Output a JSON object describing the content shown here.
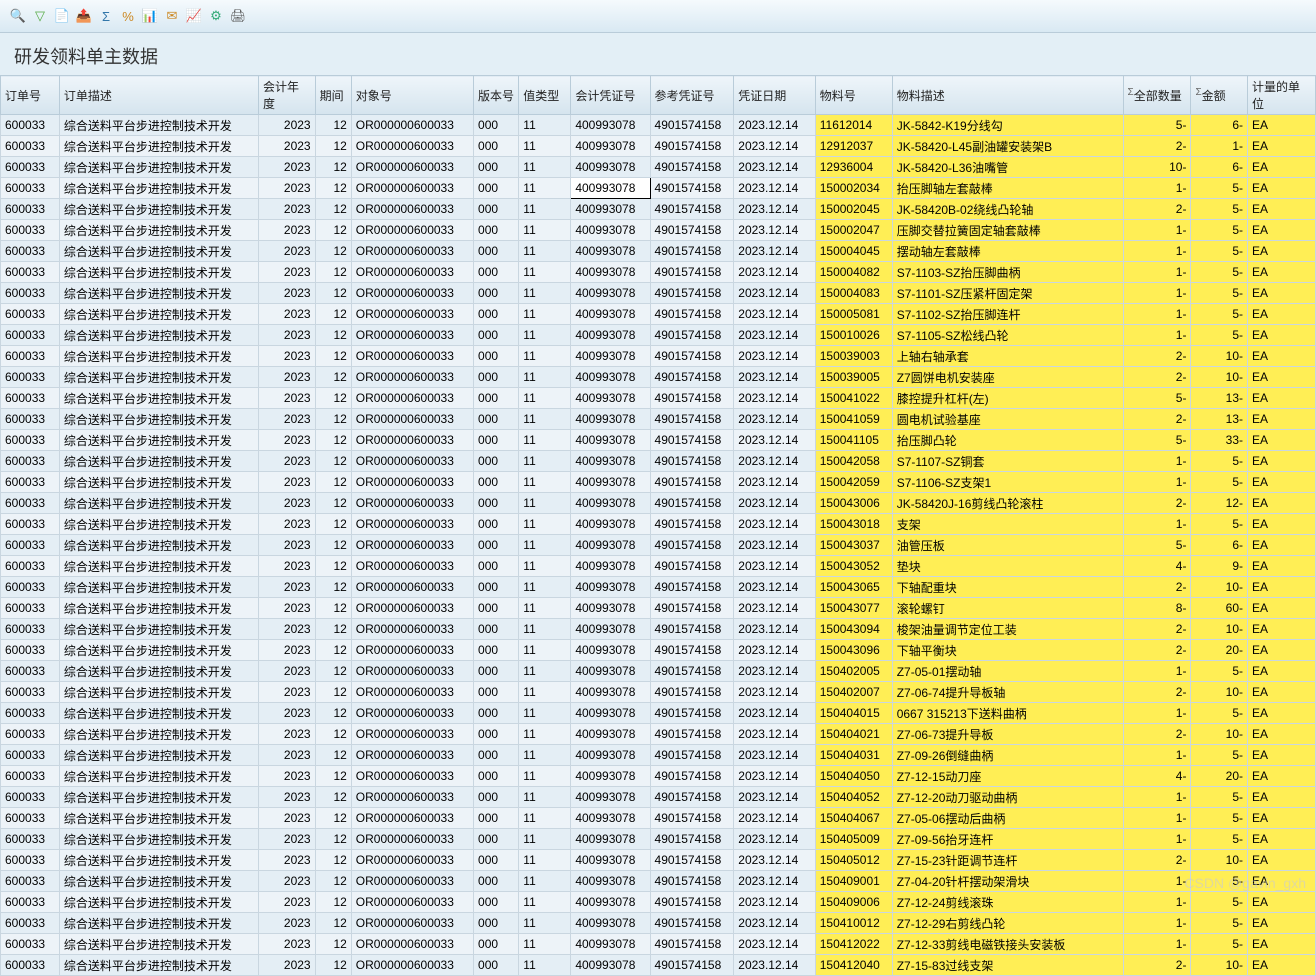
{
  "page_title": "研发领料单主数据",
  "columns": [
    "订单号",
    "订单描述",
    "会计年度",
    "期间",
    "对象号",
    "版本号",
    "值类型",
    "会计凭证号",
    "参考凭证号",
    "凭证日期",
    "物料号",
    "物料描述",
    "全部数量",
    "金额",
    "计量的单位"
  ],
  "common": {
    "order": "600033",
    "desc": "综合送料平台步进控制技术开发",
    "year": "2023",
    "period": "12",
    "obj": "OR000000600033",
    "ver": "000",
    "valtype": "11",
    "doc": "400993078",
    "ref": "4901574158",
    "date": "2023.12.14",
    "uom": "EA"
  },
  "rows": [
    {
      "mat": "11612014",
      "mdesc": "JK-5842-K19分线勾",
      "qty": "5-",
      "amt": "6-"
    },
    {
      "mat": "12912037",
      "mdesc": "JK-58420-L45副油罐安装架B",
      "qty": "2-",
      "amt": "1-"
    },
    {
      "mat": "12936004",
      "mdesc": "JK-58420-L36油嘴管",
      "qty": "10-",
      "amt": "6-"
    },
    {
      "mat": "150002034",
      "mdesc": "抬压脚轴左套敲棒",
      "qty": "1-",
      "amt": "5-",
      "sel": true
    },
    {
      "mat": "150002045",
      "mdesc": "JK-58420B-02绕线凸轮轴",
      "qty": "2-",
      "amt": "5-"
    },
    {
      "mat": "150002047",
      "mdesc": "压脚交替拉簧固定轴套敲棒",
      "qty": "1-",
      "amt": "5-"
    },
    {
      "mat": "150004045",
      "mdesc": "摆动轴左套敲棒",
      "qty": "1-",
      "amt": "5-"
    },
    {
      "mat": "150004082",
      "mdesc": "S7-1103-SZ抬压脚曲柄",
      "qty": "1-",
      "amt": "5-"
    },
    {
      "mat": "150004083",
      "mdesc": "S7-1101-SZ压紧杆固定架",
      "qty": "1-",
      "amt": "5-"
    },
    {
      "mat": "150005081",
      "mdesc": "S7-1102-SZ抬压脚连杆",
      "qty": "1-",
      "amt": "5-"
    },
    {
      "mat": "150010026",
      "mdesc": "S7-1105-SZ松线凸轮",
      "qty": "1-",
      "amt": "5-"
    },
    {
      "mat": "150039003",
      "mdesc": "上轴右轴承套",
      "qty": "2-",
      "amt": "10-"
    },
    {
      "mat": "150039005",
      "mdesc": "Z7圆饼电机安装座",
      "qty": "2-",
      "amt": "10-"
    },
    {
      "mat": "150041022",
      "mdesc": "膝控提升杠杆(左)",
      "qty": "5-",
      "amt": "13-"
    },
    {
      "mat": "150041059",
      "mdesc": "圆电机试验基座",
      "qty": "2-",
      "amt": "13-"
    },
    {
      "mat": "150041105",
      "mdesc": "抬压脚凸轮",
      "qty": "5-",
      "amt": "33-"
    },
    {
      "mat": "150042058",
      "mdesc": "S7-1107-SZ铜套",
      "qty": "1-",
      "amt": "5-"
    },
    {
      "mat": "150042059",
      "mdesc": "S7-1106-SZ支架1",
      "qty": "1-",
      "amt": "5-"
    },
    {
      "mat": "150043006",
      "mdesc": "JK-58420J-16剪线凸轮滚柱",
      "qty": "2-",
      "amt": "12-"
    },
    {
      "mat": "150043018",
      "mdesc": "支架",
      "qty": "1-",
      "amt": "5-"
    },
    {
      "mat": "150043037",
      "mdesc": "油管压板",
      "qty": "5-",
      "amt": "6-"
    },
    {
      "mat": "150043052",
      "mdesc": "垫块",
      "qty": "4-",
      "amt": "9-"
    },
    {
      "mat": "150043065",
      "mdesc": "下轴配重块",
      "qty": "2-",
      "amt": "10-"
    },
    {
      "mat": "150043077",
      "mdesc": "滚轮螺钉",
      "qty": "8-",
      "amt": "60-"
    },
    {
      "mat": "150043094",
      "mdesc": "梭架油量调节定位工装",
      "qty": "2-",
      "amt": "10-"
    },
    {
      "mat": "150043096",
      "mdesc": "下轴平衡块",
      "qty": "2-",
      "amt": "20-"
    },
    {
      "mat": "150402005",
      "mdesc": "Z7-05-01摆动轴",
      "qty": "1-",
      "amt": "5-"
    },
    {
      "mat": "150402007",
      "mdesc": "Z7-06-74提升导板轴",
      "qty": "2-",
      "amt": "10-"
    },
    {
      "mat": "150404015",
      "mdesc": "0667 315213下送料曲柄",
      "qty": "1-",
      "amt": "5-"
    },
    {
      "mat": "150404021",
      "mdesc": "Z7-06-73提升导板",
      "qty": "2-",
      "amt": "10-"
    },
    {
      "mat": "150404031",
      "mdesc": "Z7-09-26倒缝曲柄",
      "qty": "1-",
      "amt": "5-"
    },
    {
      "mat": "150404050",
      "mdesc": "Z7-12-15动刀座",
      "qty": "4-",
      "amt": "20-"
    },
    {
      "mat": "150404052",
      "mdesc": "Z7-12-20动刀驱动曲柄",
      "qty": "1-",
      "amt": "5-"
    },
    {
      "mat": "150404067",
      "mdesc": "Z7-05-06摆动后曲柄",
      "qty": "1-",
      "amt": "5-"
    },
    {
      "mat": "150405009",
      "mdesc": "Z7-09-56抬牙连杆",
      "qty": "1-",
      "amt": "5-"
    },
    {
      "mat": "150405012",
      "mdesc": "Z7-15-23针距调节连杆",
      "qty": "2-",
      "amt": "10-"
    },
    {
      "mat": "150409001",
      "mdesc": "Z7-04-20针杆摆动架滑块",
      "qty": "1-",
      "amt": "5-"
    },
    {
      "mat": "150409006",
      "mdesc": "Z7-12-24剪线滚珠",
      "qty": "1-",
      "amt": "5-"
    },
    {
      "mat": "150410012",
      "mdesc": "Z7-12-29右剪线凸轮",
      "qty": "1-",
      "amt": "5-"
    },
    {
      "mat": "150412022",
      "mdesc": "Z7-12-33剪线电磁铁接头安装板",
      "qty": "1-",
      "amt": "5-"
    },
    {
      "mat": "150412040",
      "mdesc": "Z7-15-83过线支架",
      "qty": "2-",
      "amt": "10-"
    }
  ],
  "watermark": "CSDN @gavin_gxh"
}
